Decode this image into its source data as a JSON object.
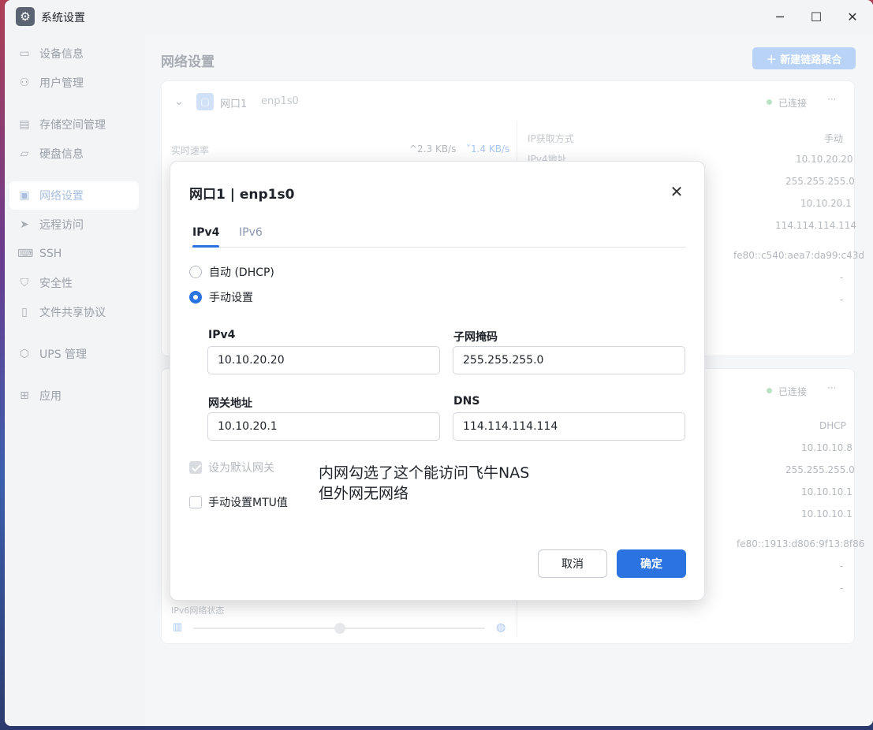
{
  "window": {
    "title": "系统设置",
    "icon": "gear-icon",
    "controls": {
      "minimize": "─",
      "maximize": "☐",
      "close": "✕"
    }
  },
  "sidebar": {
    "items": [
      {
        "label": "设备信息",
        "icon": "device-icon",
        "glyph": "▭"
      },
      {
        "label": "用户管理",
        "icon": "user-icon",
        "glyph": "⚇"
      },
      {
        "label": "存储空间管理",
        "icon": "storage-icon",
        "glyph": "▤"
      },
      {
        "label": "硬盘信息",
        "icon": "disk-icon",
        "glyph": "▱"
      },
      {
        "label": "网络设置",
        "icon": "network-icon",
        "glyph": "▣",
        "active": true
      },
      {
        "label": "远程访问",
        "icon": "send-icon",
        "glyph": "➤"
      },
      {
        "label": "SSH",
        "icon": "terminal-icon",
        "glyph": "⌨"
      },
      {
        "label": "安全性",
        "icon": "shield-icon",
        "glyph": "⛉"
      },
      {
        "label": "文件共享协议",
        "icon": "file-icon",
        "glyph": "▯"
      },
      {
        "label": "UPS 管理",
        "icon": "ups-icon",
        "glyph": "⬡"
      },
      {
        "label": "应用",
        "icon": "apps-icon",
        "glyph": "⊞"
      }
    ]
  },
  "main": {
    "page_title": "网络设置",
    "new_aggregation_button": "＋ 新建链路聚合",
    "card1": {
      "port_name": "网口1",
      "interface": "enp1s0",
      "status": "已连接",
      "more": "···",
      "realtime_speed_label": "实时速率",
      "upload": "^2.3 KB/s",
      "download": "˅1.4 KB/s",
      "ip_method_label": "IP获取方式",
      "ip_method_value": "手动",
      "ipv4_address_label": "IPv4地址",
      "values": [
        "10.10.20.20",
        "255.255.255.0",
        "10.10.20.1",
        "114.114.114.114",
        "fe80::c540:aea7:da99:c43d",
        "-",
        "-"
      ]
    },
    "card2": {
      "status": "已连接",
      "more": "···",
      "values": [
        "DHCP",
        "10.10.10.8",
        "255.255.255.0",
        "10.10.10.1",
        "10.10.10.1",
        "fe80::1913:d806:9f13:8f86",
        "-",
        "-"
      ],
      "ipv6_status_label": "IPv6网络状态"
    }
  },
  "dialog": {
    "title": "网口1 | enp1s0",
    "close": "✕",
    "tabs": [
      {
        "label": "IPv4",
        "active": true
      },
      {
        "label": "IPv6",
        "active": false
      }
    ],
    "radio_dhcp": "自动 (DHCP)",
    "radio_manual": "手动设置",
    "fields": {
      "ipv4_label": "IPv4",
      "ipv4_value": "10.10.20.20",
      "subnet_label": "子网掩码",
      "subnet_value": "255.255.255.0",
      "gateway_label": "网关地址",
      "gateway_value": "10.10.20.1",
      "dns_label": "DNS",
      "dns_value": "114.114.114.114"
    },
    "default_gateway": "设为默认网关",
    "manual_mtu": "手动设置MTU值",
    "annotation_line1": "内网勾选了这个能访问飞牛NAS",
    "annotation_line2": "但外网无网络",
    "cancel": "取消",
    "confirm": "确定"
  },
  "colors": {
    "accent": "#2a73e0",
    "status_connected": "#b9e3c4"
  }
}
